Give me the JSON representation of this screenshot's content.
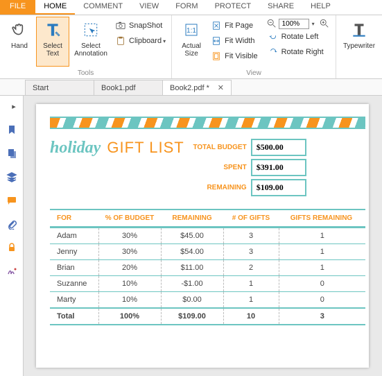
{
  "menu": {
    "file": "FILE",
    "items": [
      "HOME",
      "COMMENT",
      "VIEW",
      "FORM",
      "PROTECT",
      "SHARE",
      "HELP"
    ],
    "active_index": 0
  },
  "ribbon": {
    "tools": {
      "label": "Tools",
      "hand": "Hand",
      "select_text": "Select\nText",
      "select_annotation": "Select\nAnnotation",
      "snapshot": "SnapShot",
      "clipboard": "Clipboard"
    },
    "view": {
      "label": "View",
      "actual_size": "Actual\nSize",
      "fit_page": "Fit Page",
      "fit_width": "Fit Width",
      "fit_visible": "Fit Visible",
      "zoom": "100%",
      "rotate_left": "Rotate Left",
      "rotate_right": "Rotate Right"
    },
    "typewriter": "Typewriter"
  },
  "tabs": [
    {
      "label": "Start"
    },
    {
      "label": "Book1.pdf"
    },
    {
      "label": "Book2.pdf *",
      "active": true
    }
  ],
  "doc": {
    "holiday": "holiday",
    "giftlist": "GIFT LIST",
    "budget": [
      {
        "label": "TOTAL BUDGET",
        "value": "$500.00"
      },
      {
        "label": "SPENT",
        "value": "$391.00"
      },
      {
        "label": "REMAINING",
        "value": "$109.00"
      }
    ],
    "headers": [
      "FOR",
      "% OF BUDGET",
      "REMAINING",
      "# OF GIFTS",
      "GIFTS REMAINING"
    ],
    "rows": [
      [
        "Adam",
        "30%",
        "$45.00",
        "3",
        "1"
      ],
      [
        "Jenny",
        "30%",
        "$54.00",
        "3",
        "1"
      ],
      [
        "Brian",
        "20%",
        "$11.00",
        "2",
        "1"
      ],
      [
        "Suzanne",
        "10%",
        "-$1.00",
        "1",
        "0"
      ],
      [
        "Marty",
        "10%",
        "$0.00",
        "1",
        "0"
      ]
    ],
    "total": [
      "Total",
      "100%",
      "$109.00",
      "10",
      "3"
    ]
  }
}
